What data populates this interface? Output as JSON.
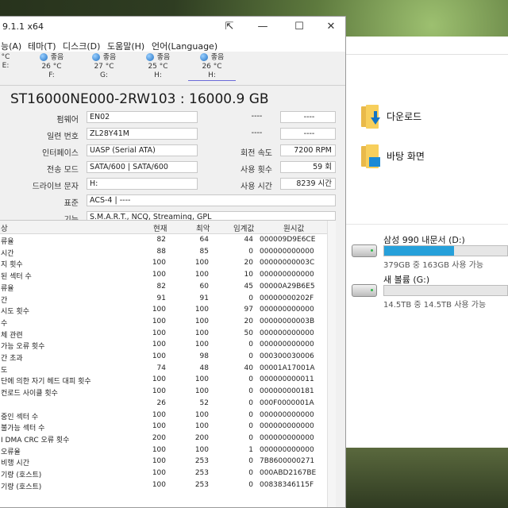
{
  "window": {
    "title": "9.1.1 x64"
  },
  "menu": [
    "능(A)",
    "테마(T)",
    "디스크(D)",
    "도움말(H)",
    "언어(Language)"
  ],
  "drive_tabs": [
    {
      "status": "°C",
      "temp": "",
      "letter": "E:"
    },
    {
      "status": "좋음",
      "temp": "26 °C",
      "letter": "F:"
    },
    {
      "status": "좋음",
      "temp": "27 °C",
      "letter": "G:"
    },
    {
      "status": "좋음",
      "temp": "25 °C",
      "letter": "H:"
    },
    {
      "status": "좋음",
      "temp": "26 °C",
      "letter": "H:"
    }
  ],
  "disk": {
    "model": "ST16000NE000-2RW103 : 16000.9 GB",
    "firmware_label": "펌웨어",
    "firmware": "EN02",
    "serial_label": "일련 번호",
    "serial": "ZL28Y41M",
    "interface_label": "인터페이스",
    "interface": "UASP (Serial ATA)",
    "transfer_label": "전송 모드",
    "transfer": "SATA/600 | SATA/600",
    "letter_label": "드라이브 문자",
    "letter": "H:",
    "standard_label": "표준",
    "standard": "ACS-4 | ----",
    "features_label": "기능",
    "features": "S.M.A.R.T., NCQ, Streaming, GPL",
    "dash": "----",
    "rpm_label": "회전 속도",
    "rpm": "7200 RPM",
    "count_label": "사용 횟수",
    "count": "59 회",
    "hours_label": "사용 시간",
    "hours": "8239 시간"
  },
  "smart": {
    "headers": [
      "상",
      "현재",
      "최악",
      "임계값",
      "원시값"
    ],
    "rows": [
      [
        "류율",
        "82",
        "64",
        "44",
        "000009D9E6CE"
      ],
      [
        "시간",
        "88",
        "85",
        "0",
        "000000000000"
      ],
      [
        "지 횟수",
        "100",
        "100",
        "20",
        "00000000003C"
      ],
      [
        "된 섹터 수",
        "100",
        "100",
        "10",
        "000000000000"
      ],
      [
        "류율",
        "82",
        "60",
        "45",
        "00000A29B6E5"
      ],
      [
        "간",
        "91",
        "91",
        "0",
        "00000000202F"
      ],
      [
        "시도 횟수",
        "100",
        "100",
        "97",
        "000000000000"
      ],
      [
        "수",
        "100",
        "100",
        "20",
        "00000000003B"
      ],
      [
        "체 관련",
        "100",
        "100",
        "50",
        "000000000000"
      ],
      [
        "가능 오류 횟수",
        "100",
        "100",
        "0",
        "000000000000"
      ],
      [
        "간 초과",
        "100",
        "98",
        "0",
        "000300030006"
      ],
      [
        "도",
        "74",
        "48",
        "40",
        "00001A17001A"
      ],
      [
        "단에 의한 자기 헤드 대피 횟수",
        "100",
        "100",
        "0",
        "000000000011"
      ],
      [
        "컨로드 사이클 횟수",
        "100",
        "100",
        "0",
        "000000000181"
      ],
      [
        "",
        "26",
        "52",
        "0",
        "000F0000001A"
      ],
      [
        "중인 섹터 수",
        "100",
        "100",
        "0",
        "000000000000"
      ],
      [
        "불가능 섹터 수",
        "100",
        "100",
        "0",
        "000000000000"
      ],
      [
        "I DMA CRC 오류 횟수",
        "200",
        "200",
        "0",
        "000000000000"
      ],
      [
        "오류율",
        "100",
        "100",
        "1",
        "000000000000"
      ],
      [
        "비행 시간",
        "100",
        "253",
        "0",
        "7B8600000271"
      ],
      [
        "기량 (호스트)",
        "100",
        "253",
        "0",
        "000ABD2167BE"
      ],
      [
        "기량 (호스트)",
        "100",
        "253",
        "0",
        "00838346115F"
      ]
    ]
  },
  "explorer": {
    "quick": [
      {
        "label": "다운로드",
        "icon": "download-folder-icon"
      },
      {
        "label": "바탕 화면",
        "icon": "desktop-folder-icon"
      }
    ],
    "drives": [
      {
        "name": "삼성 990 내문서 (D:)",
        "free": "379GB 중 163GB 사용 가능",
        "used_fraction": 0.57,
        "color": "#26a0da"
      },
      {
        "name": "새 볼륨 (G:)",
        "free": "14.5TB 중 14.5TB 사용 가능",
        "used_fraction": 0.0,
        "color": "#26a0da"
      }
    ]
  }
}
